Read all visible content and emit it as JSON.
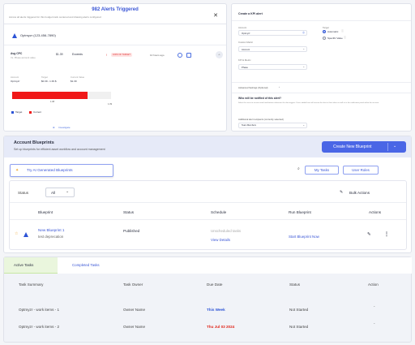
{
  "alert": {
    "title": "982 Alerts Triggered",
    "subtitle": "Across all alerts triggered for this budget track centered and drawing alerts configured",
    "org": "Optmyzr (123-456-7890)",
    "metric_name": "Avg CPC",
    "metric_sub": "Vs. Phase account value",
    "metric_value": "$1.39",
    "metric_status": "Exceeds",
    "pill": "100% OF TARGET",
    "time": "10 hours ago",
    "fields": [
      {
        "label": "Account",
        "value": "Optmyzr"
      },
      {
        "label": "Target",
        "value": "$0.39 - 1.39 $"
      },
      {
        "label": "Current Value",
        "value": "$1.39"
      }
    ],
    "bar_fill_fraction": 0.76,
    "bar_low_label": "1.08",
    "bar_high_label": "1.39",
    "legend": [
      {
        "label": "Target",
        "color": "#2c53d6"
      },
      {
        "label": "Current",
        "color": "#f01818"
      }
    ],
    "link": "Investigate"
  },
  "kpi": {
    "title": "Create a KPI alert",
    "fields": [
      {
        "label": "Account",
        "value": "Optmyzr"
      },
      {
        "label": "Custom Metric",
        "value": "Account"
      },
      {
        "label": "KPI & Metric",
        "value": "Phase"
      }
    ],
    "target_label": "Target",
    "radio_options": [
      "Automatic",
      "Specific Value"
    ],
    "advanced_label": "Advanced Settings (Optional)",
    "notify_heading": "Who will be notified of this alert?",
    "notify_desc": "Select the users to receive email notifications whenever the alert triggers. Users added here will receive the alert in their inbox as well as in the notification panel within the account.",
    "notify_select_label": "Additional alert recipients (currently selected)",
    "notify_select_value": "Team Members"
  },
  "blueprints": {
    "title": "Account Blueprints",
    "subtitle": "Set up blueprints for efficient asset workflow and account management",
    "create_button": "Create New Blueprint",
    "ai_button": "Try AI Generated Blueprints",
    "my_tasks_button": "My Tasks",
    "user_roles_button": "User Roles",
    "status_label": "Status",
    "status_value": "All",
    "bulk_actions": "Bulk Actions",
    "columns": [
      "Blueprint",
      "Status",
      "Schedule",
      "Run Blueprint",
      "Actions"
    ],
    "row": {
      "name": "New Blueprint 1",
      "desc": "test deprecation",
      "status": "Published",
      "schedule": "Unscheduled tasks",
      "view_details": "View Details",
      "run": "Start Blueprint Now"
    }
  },
  "tasks": {
    "tabs": [
      "Active Tasks",
      "Completed Tasks"
    ],
    "columns": [
      "Task Summary",
      "Task Owner",
      "Due Date",
      "Status",
      "Action"
    ],
    "rows": [
      {
        "summary": "Optmyzr - work items - 1",
        "owner": "Owner Name",
        "due": "This Week",
        "due_color": "#2c53d6",
        "status": "Not Started",
        "action": "-"
      },
      {
        "summary": "Optmyzr - work items - 2",
        "owner": "Owner Name",
        "due": "Thu Jul 03 2024",
        "due_color": "#e0261b",
        "status": "Not Started",
        "action": "-"
      }
    ]
  }
}
